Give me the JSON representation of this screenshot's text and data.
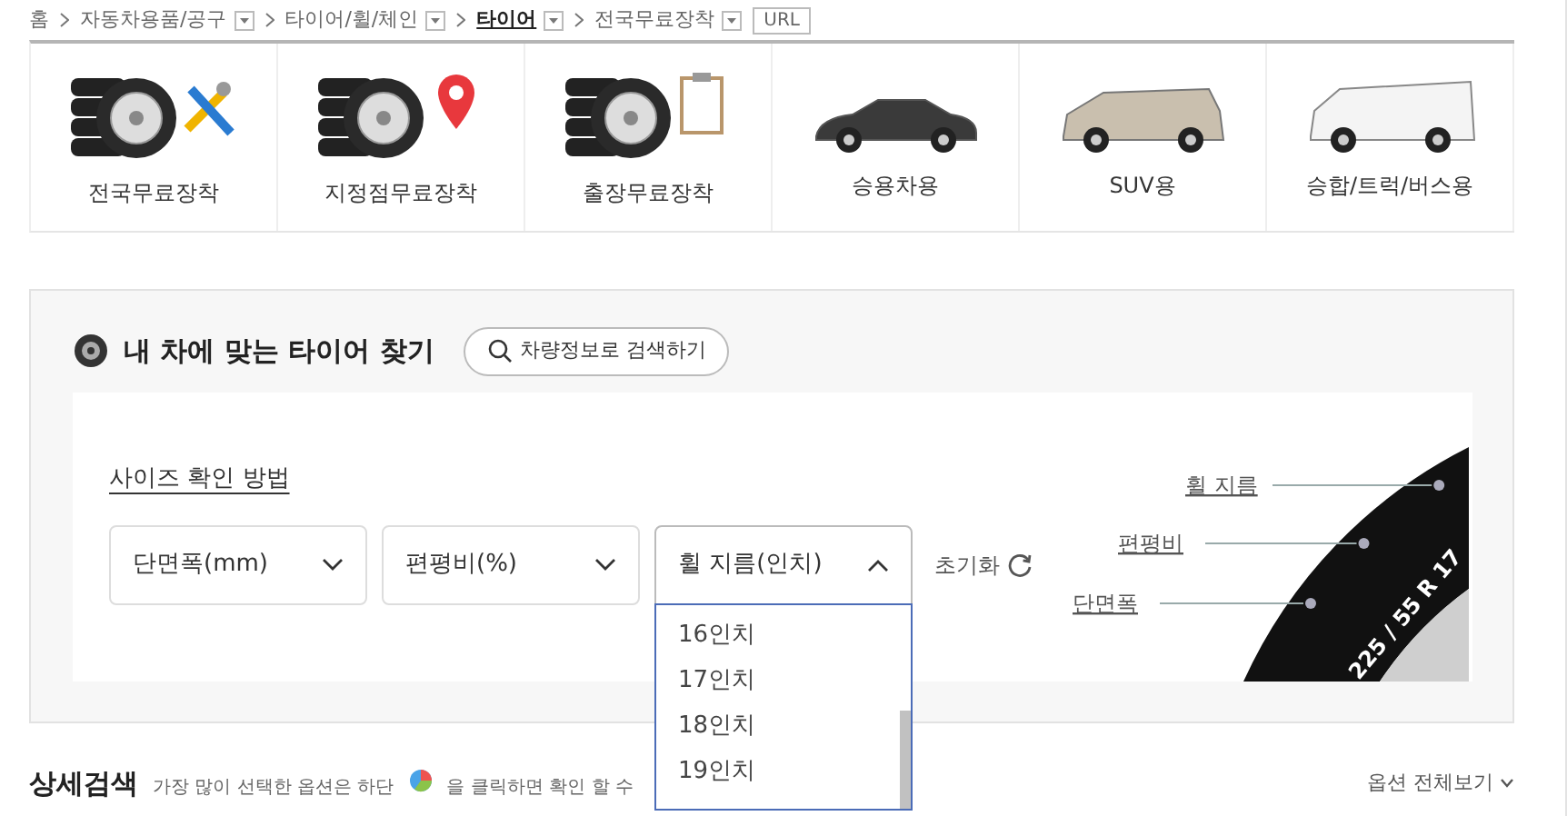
{
  "breadcrumb": {
    "items": [
      {
        "label": "홈",
        "dropdown": false,
        "current": false
      },
      {
        "label": "자동차용품/공구",
        "dropdown": true,
        "current": false
      },
      {
        "label": "타이어/휠/체인",
        "dropdown": true,
        "current": false
      },
      {
        "label": "타이어",
        "dropdown": true,
        "current": true
      },
      {
        "label": "전국무료장착",
        "dropdown": true,
        "current": false
      }
    ],
    "url_button": "URL"
  },
  "categories": [
    {
      "label": "전국무료장착",
      "kind": "tools"
    },
    {
      "label": "지정점무료장착",
      "kind": "pin"
    },
    {
      "label": "출장무료장착",
      "kind": "clipboard"
    },
    {
      "label": "승용차용",
      "kind": "sedan"
    },
    {
      "label": "SUV용",
      "kind": "minivan"
    },
    {
      "label": "승합/트럭/버스용",
      "kind": "van"
    }
  ],
  "finder": {
    "title": "내 차에 맞는 타이어 찾기",
    "vehicle_search_button": "차량정보로 검색하기",
    "size_help_link": "사이즈 확인 방법",
    "selects": [
      {
        "label": "단면폭(mm)",
        "expanded": false
      },
      {
        "label": "편평비(%)",
        "expanded": false
      },
      {
        "label": "휠 지름(인치)",
        "expanded": true,
        "options": [
          "16인치",
          "17인치",
          "18인치",
          "19인치"
        ]
      }
    ],
    "reset_button": "초기화",
    "diagram": {
      "tire_marking": "225 / 55 R 17",
      "labels": [
        "휠 지름",
        "편평비",
        "단면폭"
      ]
    }
  },
  "detail_search": {
    "title": "상세검색",
    "hint_before": "가장 많이 선택한 옵션은 하단",
    "hint_after": "을 클릭하면 확인 할 수",
    "view_all": "옵션 전체보기"
  }
}
